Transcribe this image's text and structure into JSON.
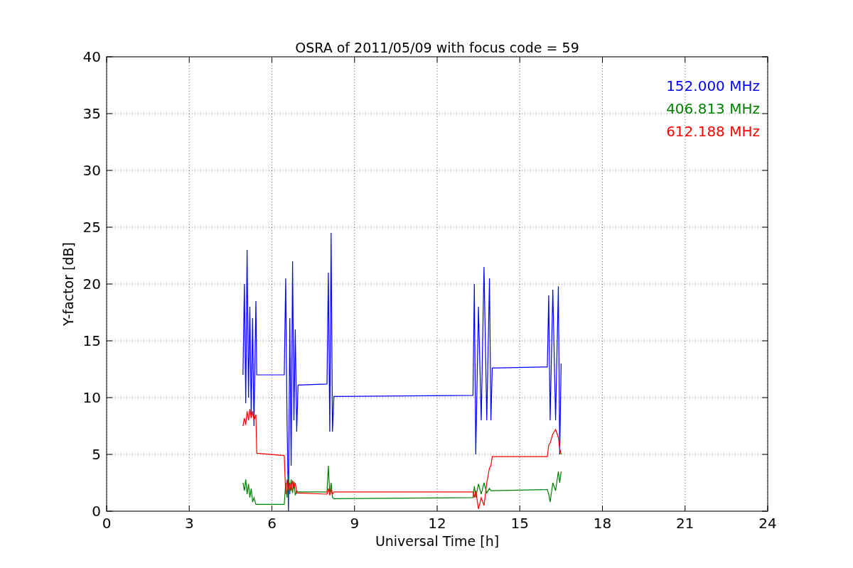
{
  "chart_data": {
    "type": "line",
    "title": "OSRA of 2011/05/09 with focus code = 59",
    "xlabel": "Universal Time [h]",
    "ylabel": "Y-factor [dB]",
    "xlim": [
      0,
      24
    ],
    "ylim": [
      0,
      40
    ],
    "xticks": [
      0,
      3,
      6,
      9,
      12,
      15,
      18,
      21,
      24
    ],
    "yticks": [
      0,
      5,
      10,
      15,
      20,
      25,
      30,
      35,
      40
    ],
    "grid": true,
    "x": [
      4.95,
      5.0,
      5.05,
      5.1,
      5.15,
      5.2,
      5.25,
      5.3,
      5.35,
      5.42,
      5.45,
      6.45,
      6.5,
      6.55,
      6.6,
      6.65,
      6.7,
      6.75,
      6.8,
      6.85,
      6.9,
      6.95,
      8.0,
      8.05,
      8.1,
      8.15,
      8.2,
      8.25,
      13.3,
      13.35,
      13.4,
      13.5,
      13.6,
      13.7,
      13.8,
      13.9,
      13.95,
      14.0,
      16.0,
      16.05,
      16.1,
      16.2,
      16.3,
      16.4,
      16.45,
      16.5
    ],
    "series": [
      {
        "name": "152.000 MHz",
        "color": "#0000ff",
        "values": [
          12,
          20,
          9.5,
          23,
          10,
          18,
          8.5,
          17,
          7.5,
          18.5,
          12,
          12,
          20.5,
          8,
          0,
          17,
          4,
          22,
          8,
          16,
          7,
          11.1,
          11.2,
          21,
          7,
          24.5,
          7,
          10.1,
          10.2,
          20,
          5,
          18,
          8,
          21.5,
          8,
          20.5,
          8,
          12.6,
          12.7,
          19,
          8,
          19.5,
          8,
          19.8,
          5,
          13
        ]
      },
      {
        "name": "406.813 MHz",
        "color": "#008000",
        "values": [
          2.5,
          1.8,
          2.8,
          1.5,
          2.4,
          1.2,
          2.0,
          0.8,
          1.2,
          0.6,
          0.6,
          0.6,
          2.5,
          1.2,
          3.2,
          1.5,
          2.8,
          1.6,
          2.6,
          1.4,
          1.8,
          1.7,
          1.7,
          4.0,
          1.5,
          2.5,
          1.2,
          1.1,
          1.2,
          2.2,
          1.2,
          2.4,
          1.5,
          2.5,
          1.6,
          2.0,
          1.8,
          1.8,
          1.9,
          1.5,
          0.8,
          2.5,
          1.8,
          3.5,
          2.5,
          3.5
        ]
      },
      {
        "name": "612.188 MHz",
        "color": "#ff0000",
        "values": [
          7.5,
          8.2,
          7.6,
          8.8,
          8.0,
          9.0,
          8.2,
          8.8,
          8.0,
          8.5,
          5.1,
          4.9,
          1.5,
          2.8,
          1.8,
          2.5,
          1.8,
          2.7,
          2.0,
          2.5,
          1.6,
          1.6,
          1.5,
          2.0,
          1.4,
          1.9,
          1.5,
          1.7,
          1.7,
          1.2,
          1.8,
          0.2,
          1.2,
          0.5,
          2.5,
          3.8,
          4.0,
          4.8,
          4.8,
          5.8,
          6.0,
          6.8,
          7.2,
          6.5,
          5.5,
          5.0
        ]
      }
    ]
  }
}
